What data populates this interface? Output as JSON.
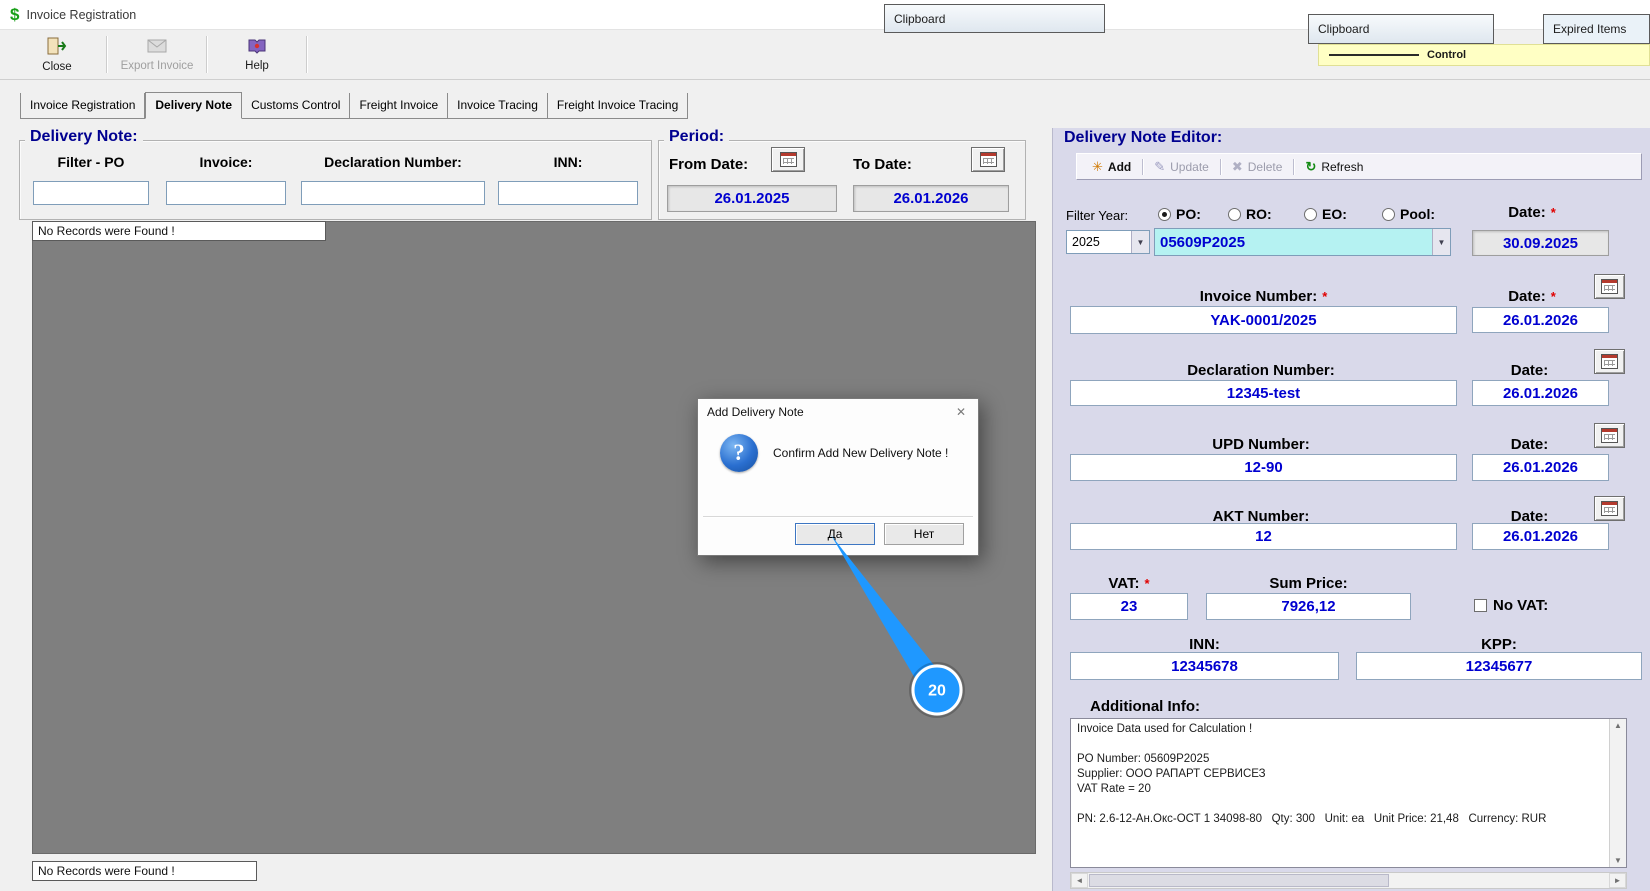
{
  "window": {
    "title": "Invoice Registration"
  },
  "overlays": {
    "clipboard_left": "Clipboard",
    "clipboard_right": "Clipboard",
    "expired_items": "Expired Items",
    "yellow_fragment": "Control"
  },
  "toolbar": {
    "close": "Close",
    "export_invoice": "Export Invoice",
    "help": "Help"
  },
  "tabs": [
    {
      "label": "Invoice Registration"
    },
    {
      "label": "Delivery Note"
    },
    {
      "label": "Customs Control"
    },
    {
      "label": "Freight Invoice"
    },
    {
      "label": "Invoice Tracing"
    },
    {
      "label": "Freight Invoice Tracing"
    }
  ],
  "delivery_note_panel": {
    "title": "Delivery Note:",
    "filters": [
      {
        "label": "Filter - PO"
      },
      {
        "label": "Invoice:"
      },
      {
        "label": "Declaration Number:"
      },
      {
        "label": "INN:"
      }
    ],
    "no_records_top": "No Records were Found !",
    "no_records_bottom": "No Records were Found !"
  },
  "period_panel": {
    "title": "Period:",
    "from_label": "From Date:",
    "from_value": "26.01.2025",
    "to_label": "To Date:",
    "to_value": "26.01.2026"
  },
  "editor_panel": {
    "title": "Delivery Note Editor:",
    "toolbar": {
      "add": "Add",
      "update": "Update",
      "delete": "Delete",
      "refresh": "Refresh"
    },
    "filter_year_label": "Filter Year:",
    "radios": [
      {
        "label": "PO:",
        "checked": true
      },
      {
        "label": "RO:",
        "checked": false
      },
      {
        "label": "EO:",
        "checked": false
      },
      {
        "label": "Pool:",
        "checked": false
      }
    ],
    "year_value": "2025",
    "po_value": "05609P2025",
    "po_date_label": "Date:",
    "po_date_required": "*",
    "po_date_value": "30.09.2025",
    "rows": [
      {
        "label": "Invoice Number:",
        "required": "*",
        "value": "YAK-0001/2025",
        "date_label": "Date:",
        "date_required": "*",
        "date_value": "26.01.2026"
      },
      {
        "label": "Declaration Number:",
        "required": "",
        "value": "12345-test",
        "date_label": "Date:",
        "date_required": "",
        "date_value": "26.01.2026"
      },
      {
        "label": "UPD Number:",
        "required": "",
        "value": "12-90",
        "date_label": "Date:",
        "date_required": "",
        "date_value": "26.01.2026"
      },
      {
        "label": "AKT Number:",
        "required": "",
        "value": "12",
        "date_label": "Date:",
        "date_required": "",
        "date_value": "26.01.2026"
      }
    ],
    "vat_label": "VAT:",
    "vat_required": "*",
    "vat_value": "23",
    "sum_price_label": "Sum Price:",
    "sum_price_value": "7926,12",
    "no_vat_label": "No VAT:",
    "inn_label": "INN:",
    "inn_value": "12345678",
    "kpp_label": "KPP:",
    "kpp_value": "12345677",
    "additional_info_label": "Additional Info:",
    "additional_info": "Invoice Data used for Calculation !\n\nPO Number: 05609P2025\nSupplier: ООО РАПАРТ СЕРВИСЕЗ\nVAT Rate = 20\n\nPN: 2.6-12-Ан.Окс-ОСТ 1 34098-80   Qty: 300   Unit: ea   Unit Price: 21,48   Currency: RUR"
  },
  "dialog": {
    "title": "Add Delivery Note",
    "message": "Confirm Add New Delivery Note !",
    "yes_label": "Да",
    "no_label": "Нет"
  },
  "annotation": {
    "step_number": "20"
  },
  "icons": {
    "dollar": "$",
    "close_x": "✕",
    "question_mark": "?",
    "dropdown": "▼",
    "add_glyph": "✳",
    "update_glyph": "✎",
    "delete_glyph": "✖",
    "refresh_glyph": "↻",
    "arrow_up": "▲",
    "arrow_down": "▼",
    "arrow_left": "◄",
    "arrow_right": "►"
  },
  "colors": {
    "value_text": "#0000d0",
    "section_heading": "#000090",
    "po_field_bg": "#b5f2f2",
    "required_mark": "#e00000",
    "annotation_blue": "#1f98ff",
    "grid_bg": "#7f7f7f"
  }
}
